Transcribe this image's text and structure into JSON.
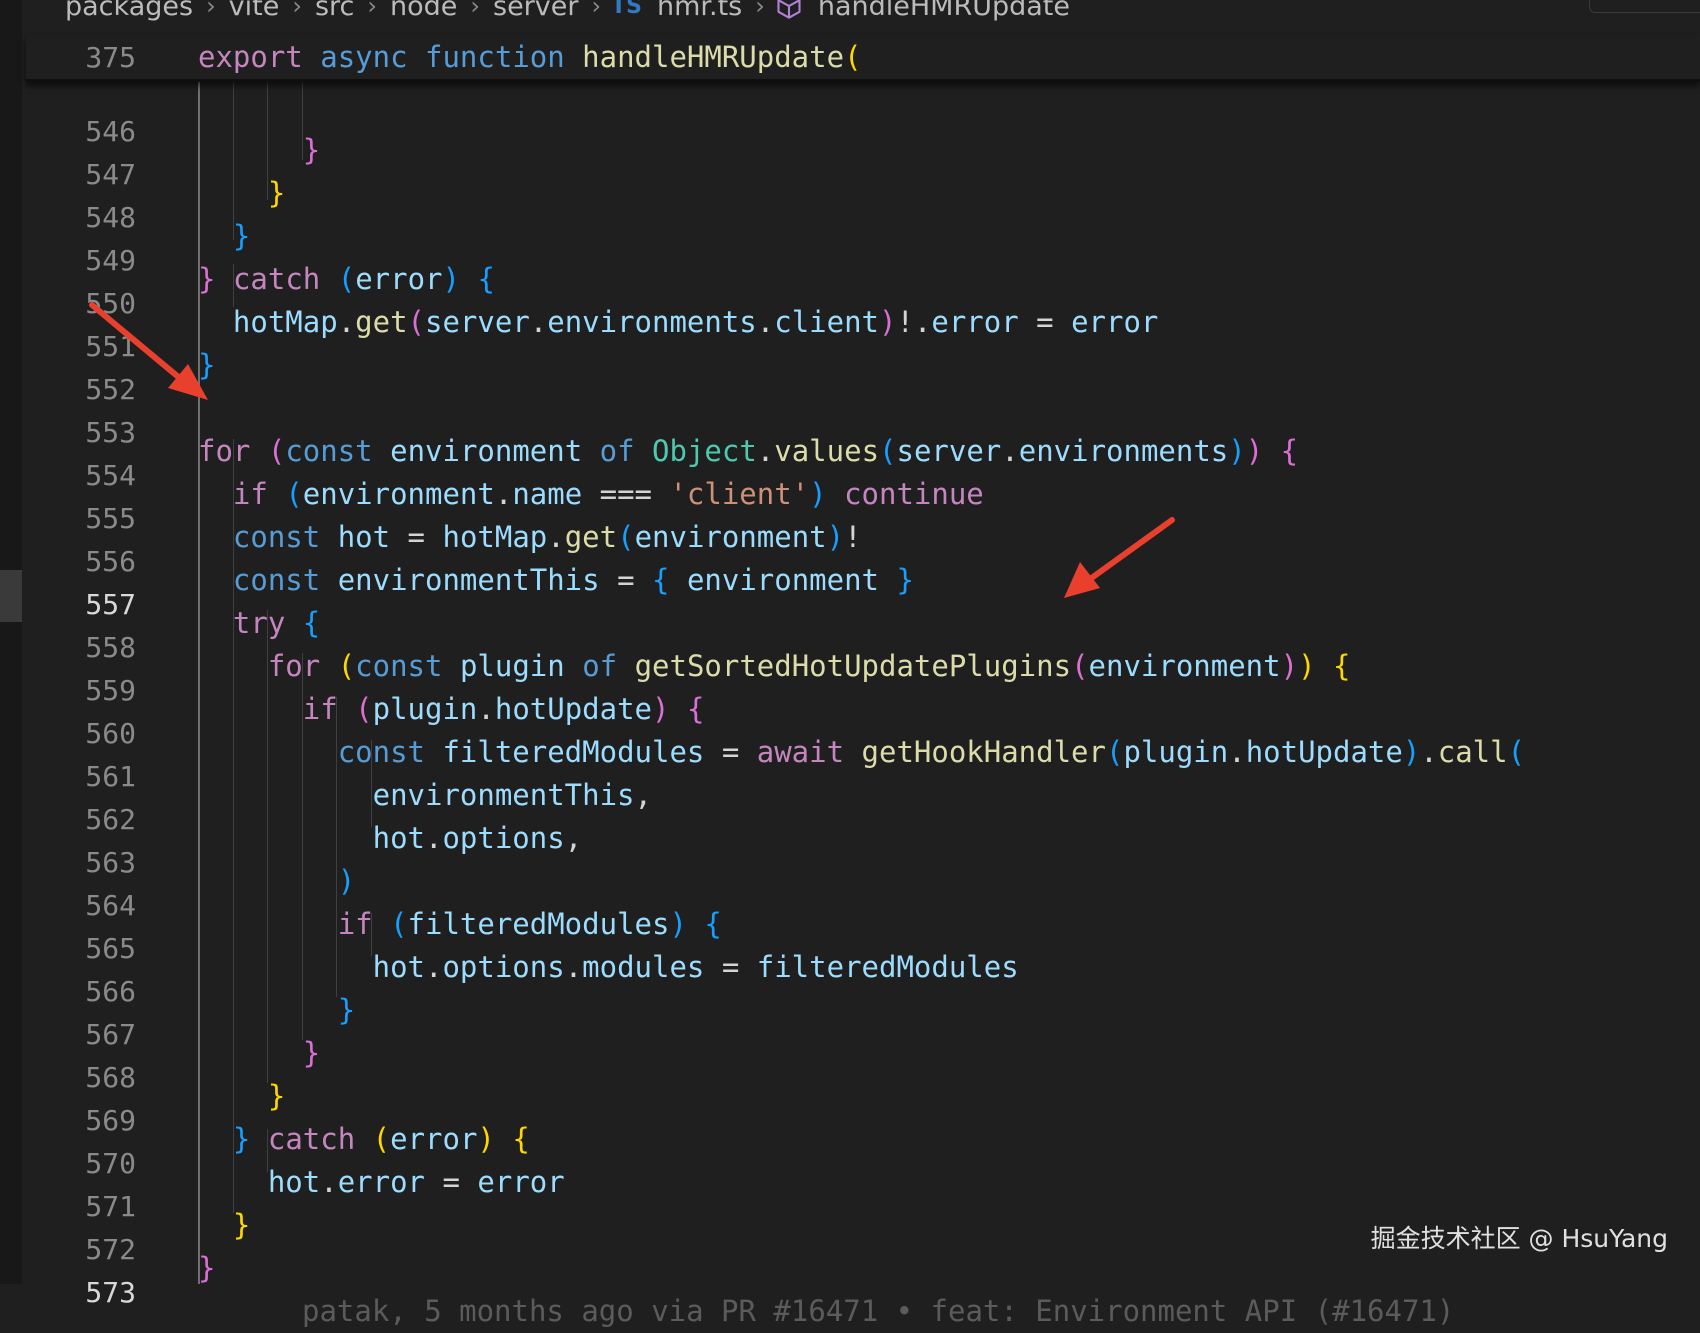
{
  "breadcrumb": {
    "items": [
      "packages",
      "vite",
      "src",
      "node",
      "server"
    ],
    "file_badge": "TS",
    "file": "hmr.ts",
    "symbol": "handleHMRUpdate"
  },
  "sticky": {
    "line": "375",
    "code": "export async function handleHMRUpdate("
  },
  "lines": {
    "l546": "546",
    "l547": "547",
    "l548": "548",
    "l549": "549",
    "l550": "550",
    "l551": "551",
    "l552": "552",
    "l553": "553",
    "l554": "554",
    "l555": "555",
    "l556": "556",
    "l557": "557",
    "l558": "558",
    "l559": "559",
    "l560": "560",
    "l561": "561",
    "l562": "562",
    "l563": "563",
    "l564": "564",
    "l565": "565",
    "l566": "566",
    "l567": "567",
    "l568": "568",
    "l569": "569",
    "l570": "570",
    "l571": "571",
    "l572": "572",
    "l573": "573"
  },
  "blame": "patak, 5 months ago via PR #16471 • feat: Environment API (#16471)",
  "watermark": "掘金技术社区 @ HsuYang",
  "colors": {
    "background": "#1f1f1f",
    "keyword": "#c586c0",
    "storage": "#569cd6",
    "function": "#dcdcaa",
    "variable": "#9cdcfe",
    "type": "#4ec9b0",
    "string": "#ce9178",
    "annotation_arrow": "#e8402c"
  }
}
